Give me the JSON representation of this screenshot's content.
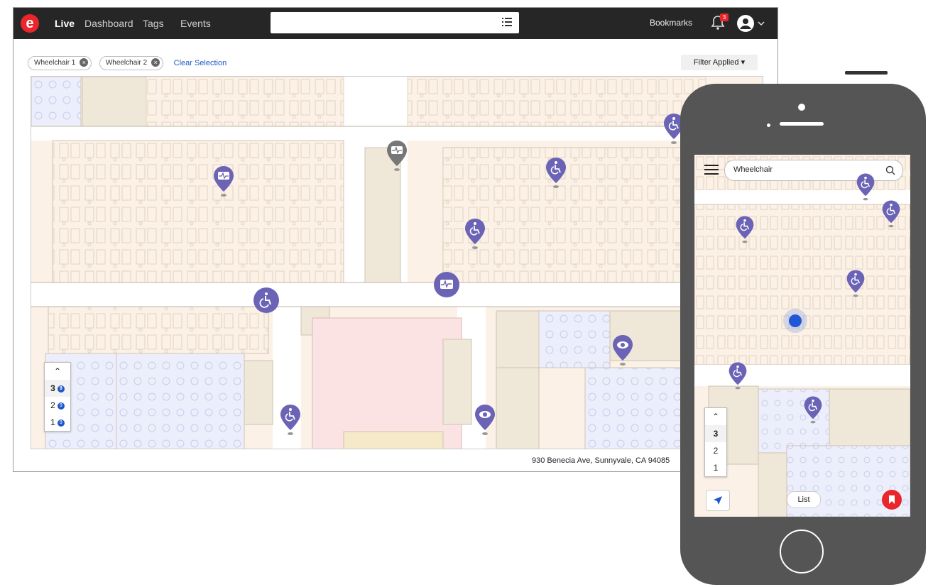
{
  "app": {
    "nav": [
      "Live",
      "Dashboard",
      "Tags",
      "Events"
    ],
    "bookmarks_label": "Bookmarks",
    "notification_count": "3"
  },
  "filters": {
    "chips": [
      "Wheelchair 1",
      "Wheelchair 2"
    ],
    "clear_label": "Clear Selection",
    "filter_button": "Filter Applied"
  },
  "map": {
    "address": "930 Benecia Ave, Sunnyvale, CA 94085",
    "floors": [
      {
        "label": "3",
        "badge": "9"
      },
      {
        "label": "2",
        "badge": "9"
      },
      {
        "label": "1",
        "badge": "9"
      }
    ],
    "selected_floor": "3"
  },
  "phone": {
    "search_value": "Wheelchair",
    "floors": [
      "3",
      "2",
      "1"
    ],
    "list_label": "List"
  },
  "colors": {
    "topbar": "#262626",
    "brand": "#e8262b",
    "marker": "#6b63b5",
    "link": "#1f57c8",
    "office": "#fbf1e6",
    "conference": "#eceffb",
    "lab": "#fbe3e3"
  }
}
